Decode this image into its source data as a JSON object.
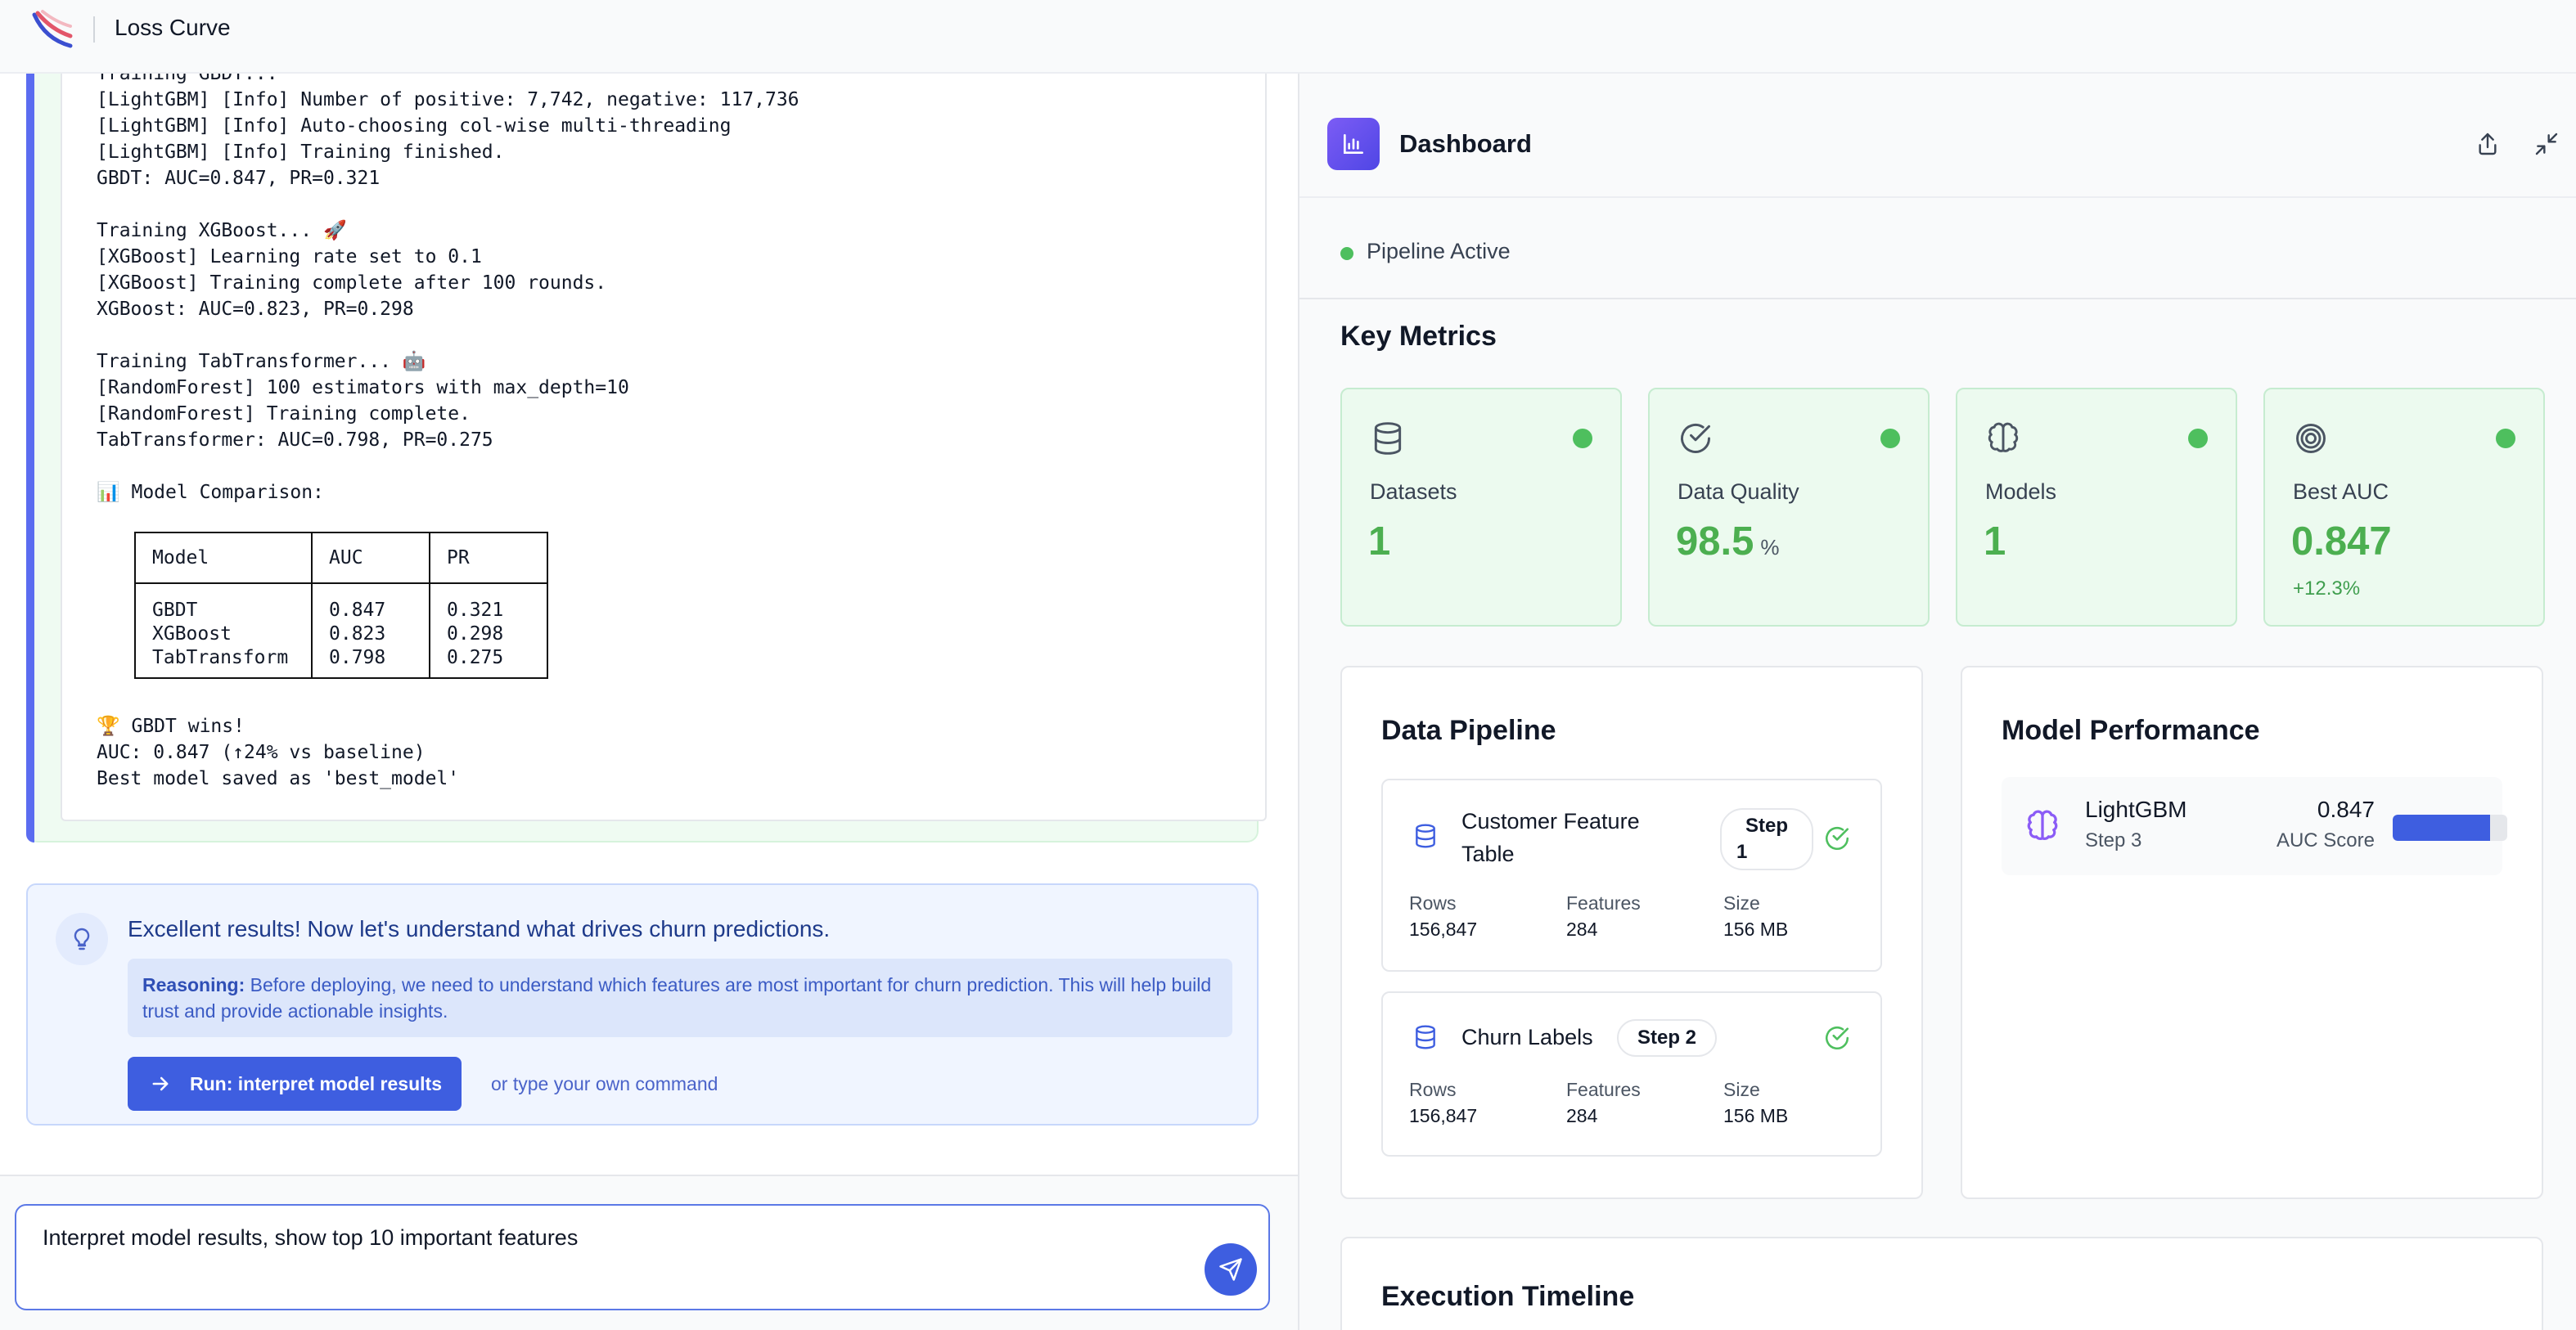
{
  "app": {
    "title": "Loss Curve"
  },
  "console": {
    "cut_line": "Training GBDT... ",
    "lines": [
      "[LightGBM] [Info] Number of positive: 7,742, negative: 117,736",
      "[LightGBM] [Info] Auto-choosing col-wise multi-threading",
      "[LightGBM] [Info] Training finished.",
      "GBDT: AUC=0.847, PR=0.321",
      "",
      "Training XGBoost... 🚀",
      "[XGBoost] Learning rate set to 0.1",
      "[XGBoost] Training complete after 100 rounds.",
      "XGBoost: AUC=0.823, PR=0.298",
      "",
      "Training TabTransformer... 🤖",
      "[RandomForest] 100 estimators with max_depth=10",
      "[RandomForest] Training complete.",
      "TabTransformer: AUC=0.798, PR=0.275",
      "",
      "📊 Model Comparison:"
    ],
    "table": {
      "headers": [
        "Model",
        "AUC",
        "PR"
      ],
      "rows": [
        [
          "GBDT",
          "0.847",
          "0.321"
        ],
        [
          "XGBoost",
          "0.823",
          "0.298"
        ],
        [
          "TabTransform",
          "0.798",
          "0.275"
        ]
      ]
    },
    "footer_lines": [
      "🏆 GBDT wins!",
      "AUC: 0.847 (↑24% vs baseline)",
      "Best model saved as 'best_model'"
    ]
  },
  "suggestion": {
    "headline": "Excellent results! Now let's understand what drives churn predictions.",
    "reason_label": "Reasoning:",
    "reason_text": " Before deploying, we need to understand which features are most important for churn prediction. This will help build trust and provide actionable insights.",
    "run_label": "Run: interpret model results",
    "alt_text": "or type your own command"
  },
  "command": {
    "value": "Interpret model results, show top 10 important features"
  },
  "dashboard": {
    "title": "Dashboard",
    "status": "Pipeline Active",
    "key_metrics_title": "Key Metrics",
    "metrics": [
      {
        "label": "Datasets",
        "value": "1",
        "unit": "",
        "sub": "",
        "icon": "database-icon"
      },
      {
        "label": "Data Quality",
        "value": "98.5",
        "unit": "%",
        "sub": "",
        "icon": "check-circle-icon"
      },
      {
        "label": "Models",
        "value": "1",
        "unit": "",
        "sub": "",
        "icon": "brain-icon"
      },
      {
        "label": "Best AUC",
        "value": "0.847",
        "unit": "",
        "sub": "+12.3%",
        "icon": "target-icon"
      }
    ],
    "pipeline": {
      "title": "Data Pipeline",
      "steps": [
        {
          "name_line1": "Customer Feature",
          "name_line2": "Table",
          "badge_line1": "Step",
          "badge_line2": "1",
          "rows_label": "Rows",
          "rows": "156,847",
          "features_label": "Features",
          "features": "284",
          "size_label": "Size",
          "size": "156 MB"
        },
        {
          "name_line1": "Churn Labels",
          "name_line2": "",
          "badge_line1": "Step 2",
          "badge_line2": "",
          "rows_label": "Rows",
          "rows": "156,847",
          "features_label": "Features",
          "features": "284",
          "size_label": "Size",
          "size": "156 MB"
        }
      ]
    },
    "performance": {
      "title": "Model Performance",
      "model": "LightGBM",
      "step": "Step 3",
      "score": "0.847",
      "score_label": "AUC Score",
      "score_fraction": 0.847
    },
    "timeline_title": "Execution Timeline"
  },
  "colors": {
    "accent": "#3e5ee0",
    "success": "#4caf50",
    "metric_bg": "#ecfaef"
  }
}
